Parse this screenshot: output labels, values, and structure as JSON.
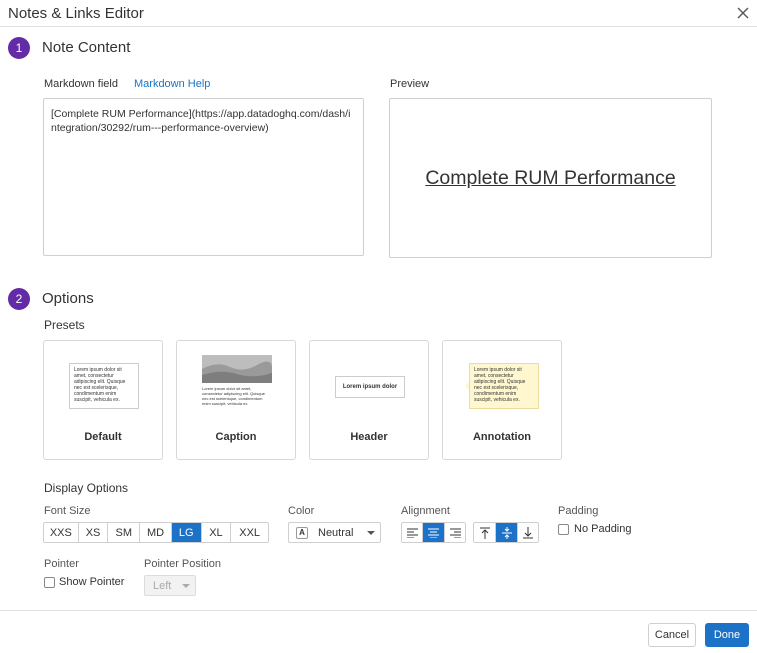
{
  "dialog": {
    "title": "Notes & Links Editor"
  },
  "note_content": {
    "step": "1",
    "title": "Note Content",
    "markdown_label": "Markdown field",
    "markdown_help": "Markdown Help",
    "markdown_value": "[Complete RUM Performance](https://app.datadoghq.com/dash/integration/30292/rum---performance-overview)",
    "preview_label": "Preview",
    "preview_link_text": "Complete RUM Performance"
  },
  "options": {
    "step": "2",
    "title": "Options",
    "presets_label": "Presets",
    "presets": [
      {
        "label": "Default",
        "sample": "Lorem ipsum dolor sit amet, consectetur adipiscing elit. Quisque nec est scelerisque, condimentum enim suscipit, vehicula ex."
      },
      {
        "label": "Caption",
        "sample": "Lorem ipsum dolor sit amet, consectetur adipiscing elit. Quisque nec est scelerisque, condimentum enim suscipit, vehicula ex."
      },
      {
        "label": "Header",
        "sample": "Lorem ipsum dolor"
      },
      {
        "label": "Annotation",
        "sample": "Lorem ipsum dolor sit amet, consectetur adipiscing elit. Quisque nec est scelerisque, condimentum enim suscipit, vehicula ex."
      }
    ],
    "display_options_label": "Display Options",
    "font_size": {
      "label": "Font Size",
      "options": [
        "XXS",
        "XS",
        "SM",
        "MD",
        "LG",
        "XL",
        "XXL"
      ],
      "selected": "LG"
    },
    "color": {
      "label": "Color",
      "icon_glyph": "A",
      "value": "Neutral"
    },
    "alignment": {
      "label": "Alignment",
      "horizontal_selected": "center",
      "vertical_selected": "middle"
    },
    "padding": {
      "label": "Padding",
      "checkbox_label": "No Padding",
      "checked": false
    },
    "pointer": {
      "label": "Pointer",
      "checkbox_label": "Show Pointer",
      "checked": false
    },
    "pointer_position": {
      "label": "Pointer Position",
      "value": "Left",
      "disabled": true
    }
  },
  "footer": {
    "cancel": "Cancel",
    "done": "Done"
  },
  "colors": {
    "accent": "#1c72c7",
    "step_badge": "#632ca6",
    "link": "#1a73c8",
    "annotation_bg": "#fff7cf"
  }
}
